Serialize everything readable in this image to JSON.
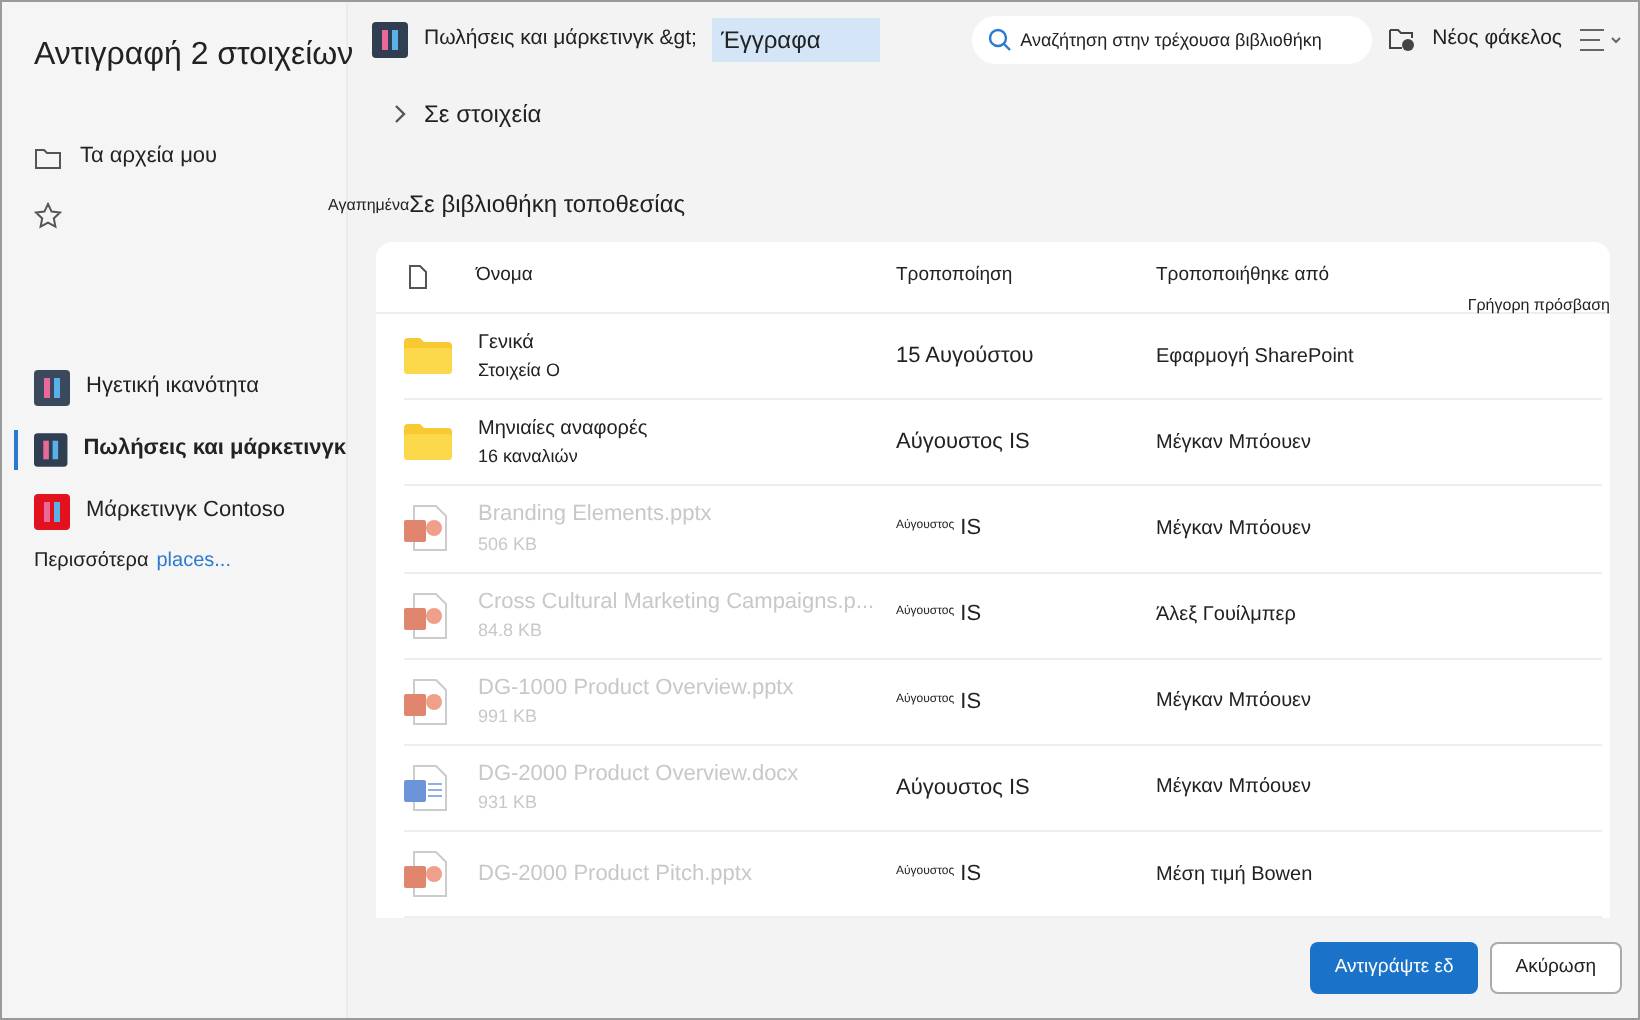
{
  "sidebar": {
    "title": "Αντιγραφή 2 στοιχείων",
    "quick_items": [
      {
        "kind": "folder",
        "label": "Τα αρχεία μου"
      },
      {
        "kind": "star"
      }
    ],
    "sites": [
      {
        "label": "Ηγετική ικανότητα",
        "color": "#3a4a5c",
        "selected": false
      },
      {
        "label": "Πωλήσεις και μάρκετινγκ",
        "color": "#2f3e50",
        "selected": true
      },
      {
        "label": "Μάρκετινγκ Contoso",
        "color": "#e3101e",
        "selected": false
      }
    ],
    "more": {
      "label": "Περισσότερα",
      "link": "places..."
    }
  },
  "header": {
    "breadcrumb": "Πωλήσεις και μάρκετινγκ &gt;",
    "current": "Έγγραφα",
    "search": {
      "placeholder": "Αναζήτηση στην τρέχουσα βιβλιοθήκη"
    },
    "new_folder": "Νέος φάκελος"
  },
  "sections": [
    {
      "label": "Σε στοιχεία",
      "expanded": false
    },
    {
      "label": "Σε βιβλιοθήκη τοποθεσίας",
      "prefix": "Αγαπημένα"
    }
  ],
  "table": {
    "columns": [
      "Όνομα",
      "Τροποποίηση",
      "Τροποποιήθηκε από",
      "Γρήγορη πρόσβαση"
    ],
    "rows": [
      {
        "kind": "folder",
        "name": "Γενικά",
        "sub": "Στοιχεία Ο",
        "modified": "15 Αυγούστου",
        "modified_by": "Εφαρμογή SharePoint",
        "disabled": false
      },
      {
        "kind": "folder",
        "name": "Μηνιαίες αναφορές",
        "sub": "16 καναλιών",
        "modified": "Αύγουστος IS",
        "modified_by": "Μέγκαν Μπόουεν",
        "disabled": false
      },
      {
        "kind": "pptx",
        "name": "Branding Elements.pptx",
        "sub": "506 KB",
        "modified": "$^{Αύγουστος}$ IS",
        "modified_by": "Μέγκαν Μπόουεν",
        "disabled": true
      },
      {
        "kind": "pptx",
        "name": "Cross Cultural Marketing Campaigns.p...",
        "sub": "84.8 KB",
        "modified": "$^{Αύγουστος}$ IS",
        "modified_by": "Άλεξ Γουίλμπερ",
        "disabled": true
      },
      {
        "kind": "pptx",
        "name": "DG-1000 Product Overview.pptx",
        "sub": "991 KB",
        "modified": "$^{Αύγουστος}$ IS",
        "modified_by": "Μέγκαν Μπόουεν",
        "disabled": true
      },
      {
        "kind": "docx",
        "name": "DG-2000 Product Overview.docx",
        "sub": "931 KB",
        "modified": "Αύγουστος IS",
        "modified_by": "Μέγκαν Μπόουεν",
        "disabled": true
      },
      {
        "kind": "pptx",
        "name": "DG-2000 Product Pitch.pptx",
        "modified": "$^{Αύγουστος}$ IS",
        "modified_by": "Μέση τιμή Bowen",
        "disabled": true
      }
    ]
  },
  "buttons": [
    {
      "kind": "primary",
      "label": "Αντιγράψτε εδ"
    },
    {
      "kind": "secondary",
      "label": "Ακύρωση"
    }
  ]
}
